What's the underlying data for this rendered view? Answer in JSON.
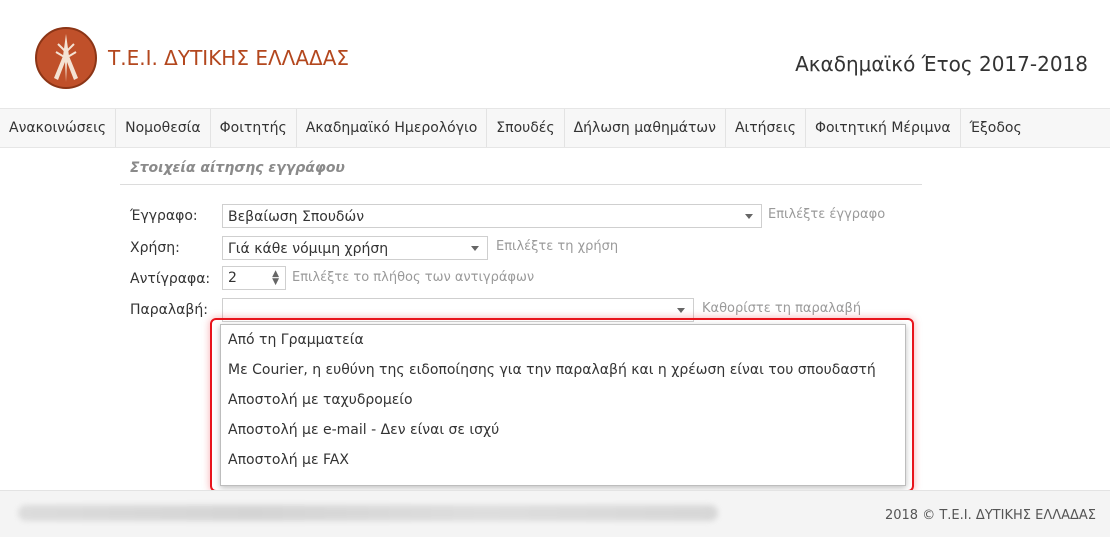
{
  "header": {
    "site_title": "Τ.Ε.Ι. ΔΥΤΙΚΗΣ ΕΛΛΑΔΑΣ",
    "academic_year": "Ακαδημαϊκό Έτος 2017-2018",
    "logo_icon": "tei-logo-icon"
  },
  "nav": {
    "items": [
      {
        "label": "Ανακοινώσεις"
      },
      {
        "label": "Νομοθεσία"
      },
      {
        "label": "Φοιτητής"
      },
      {
        "label": "Ακαδημαϊκό Ημερολόγιο"
      },
      {
        "label": "Σπουδές"
      },
      {
        "label": "Δήλωση μαθημάτων"
      },
      {
        "label": "Αιτήσεις"
      },
      {
        "label": "Φοιτητική Μέριμνα"
      },
      {
        "label": "Έξοδος"
      }
    ]
  },
  "form": {
    "section_title": "Στοιχεία αίτησης εγγράφου",
    "document": {
      "label": "Έγγραφο:",
      "value": "Βεβαίωση Σπουδών",
      "hint": "Επιλέξτε έγγραφο"
    },
    "usage": {
      "label": "Χρήση:",
      "value": "Γιά κάθε νόμιμη χρήση",
      "hint": "Επιλέξτε τη χρήση"
    },
    "copies": {
      "label": "Αντίγραφα:",
      "value": "2",
      "hint": "Επιλέξτε το πλήθος των αντιγράφων"
    },
    "delivery": {
      "label": "Παραλαβή:",
      "value": "",
      "hint": "Καθορίστε τη παραλαβή"
    }
  },
  "delivery_options": [
    "Από τη Γραμματεία",
    "Με Courier, η ευθύνη της ειδοποίησης για την παραλαβή και η χρέωση είναι του σπουδαστή",
    "Αποστολή με ταχυδρομείο",
    "Αποστολή με e-mail - Δεν είναι σε ισχύ",
    "Αποστολή με FAX"
  ],
  "footer": {
    "copyright": "2018 © Τ.Ε.Ι. ΔΥΤΙΚΗΣ ΕΛΛΑΔΑΣ"
  },
  "colors": {
    "brand": "#b3471e",
    "highlight": "#e8141c"
  }
}
